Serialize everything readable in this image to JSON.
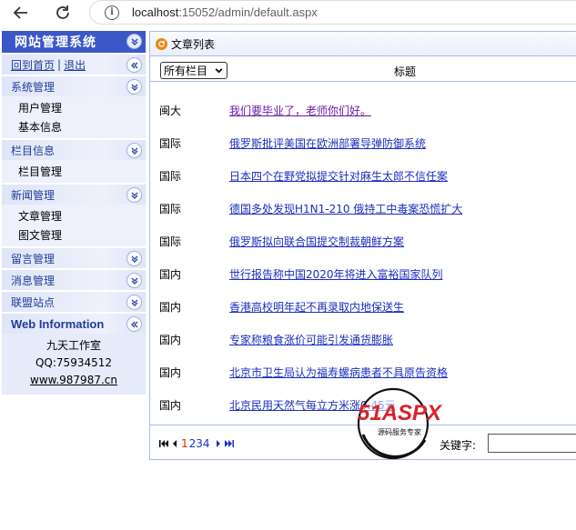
{
  "browser": {
    "url_host": "localhost",
    "url_rest": ":15052/admin/default.aspx"
  },
  "sidebar": {
    "title": "网站管理系统",
    "home_link": "回到首页",
    "separator": "|",
    "logout_link": "退出",
    "sections": [
      {
        "label": "系统管理",
        "items": [
          "用户管理",
          "基本信息"
        ]
      },
      {
        "label": "栏目信息",
        "items": [
          "栏目管理"
        ]
      },
      {
        "label": "新闻管理",
        "items": [
          "文章管理",
          "图文管理"
        ]
      },
      {
        "label": "留言管理",
        "items": []
      },
      {
        "label": "消息管理",
        "items": []
      },
      {
        "label": "联盟站点",
        "items": []
      }
    ],
    "web_info": {
      "label": "Web Information",
      "studio": "九天工作室",
      "qq": "QQ:75934512",
      "site": "www.987987.cn"
    }
  },
  "main": {
    "title": "文章列表",
    "category_select": {
      "selected": "所有栏目"
    },
    "column_title": "标题",
    "rows": [
      {
        "category": "闽大",
        "title": "我们要毕业了，老师你们好。"
      },
      {
        "category": "国际",
        "title": "俄罗斯批评美国在欧洲部署导弹防御系统"
      },
      {
        "category": "国际",
        "title": "日本四个在野党拟提交针对麻生太郎不信任案"
      },
      {
        "category": "国际",
        "title": "德国多处发现H1N1-210 俄持工中毒案恐慌扩大"
      },
      {
        "category": "国际",
        "title": "俄罗斯拟向联合国提交制裁朝鲜方案"
      },
      {
        "category": "国内",
        "title": "世行报告称中国2020年将进入富裕国家队列"
      },
      {
        "category": "国内",
        "title": "香港高校明年起不再录取内地保送生"
      },
      {
        "category": "国内",
        "title": "专家称粮食涨价可能引发通货膨胀"
      },
      {
        "category": "国内",
        "title": "北京市卫生局认为福寿螺病患者不具原告资格"
      },
      {
        "category": "国内",
        "title": "北京民用天然气每立方米涨0.45元"
      }
    ],
    "pager": {
      "current": "1",
      "pages": [
        "2",
        "3",
        "4"
      ]
    },
    "search_label": "关键字:",
    "search_value": ""
  },
  "watermark": {
    "brand": "51ASPX",
    "tagline": "源码服务专家"
  },
  "colors": {
    "sidebar_header": "#3b57c8",
    "link": "#1a2fbf",
    "visited": "#6b1aa8",
    "border": "#a9bce6"
  }
}
